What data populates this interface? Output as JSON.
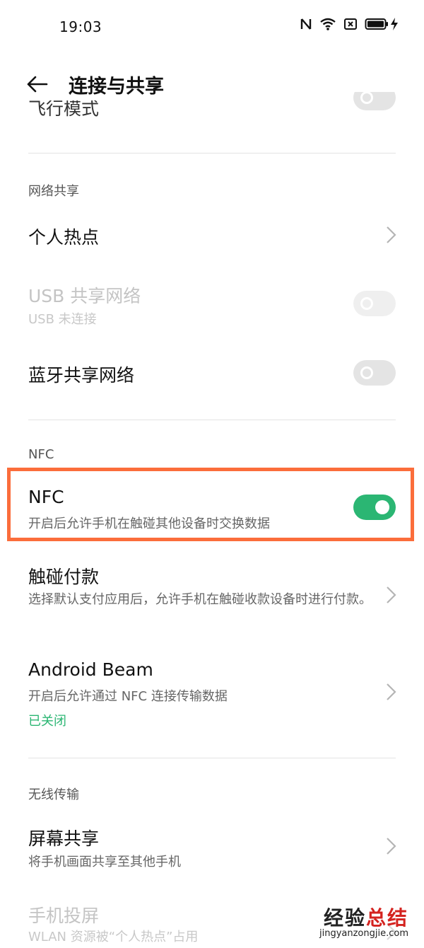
{
  "status_bar": {
    "time": "19:03",
    "icons": [
      "nfc-icon",
      "wifi-icon",
      "sim-off-icon",
      "battery-icon",
      "charging-icon"
    ]
  },
  "header": {
    "back_icon": "arrow-left-icon",
    "title": "连接与共享"
  },
  "clipped_row": {
    "label": "飞行模式",
    "toggle_on": false
  },
  "sections": {
    "network_sharing": {
      "label": "网络共享",
      "hotspot": {
        "title": "个人热点"
      },
      "usb_tethering": {
        "title": "USB 共享网络",
        "subtitle": "USB 未连接",
        "enabled": false,
        "toggle_on": false
      },
      "bt_tethering": {
        "title": "蓝牙共享网络",
        "toggle_on": false
      }
    },
    "nfc": {
      "label": "NFC",
      "nfc_toggle": {
        "title": "NFC",
        "subtitle": "开启后允许手机在触碰其他设备时交换数据",
        "toggle_on": true
      },
      "tap_pay": {
        "title": "触碰付款",
        "subtitle": "选择默认支付应用后，允许手机在触碰收款设备时进行付款。"
      },
      "android_beam": {
        "title": "Android Beam",
        "subtitle": "开启后允许通过 NFC 连接传输数据",
        "status": "已关闭"
      }
    },
    "wireless": {
      "label": "无线传输",
      "screen_share": {
        "title": "屏幕共享",
        "subtitle": "将手机画面共享至其他手机"
      },
      "screencast": {
        "title": "手机投屏",
        "subtitle": "WLAN 资源被“个人热点”占用"
      }
    }
  },
  "colors": {
    "accent_green": "#2bb673",
    "highlight_orange": "#fb6d3b"
  },
  "watermark": {
    "brand_part1": "经验",
    "brand_part2": "总结",
    "url": "jingyanzongjie.com"
  }
}
